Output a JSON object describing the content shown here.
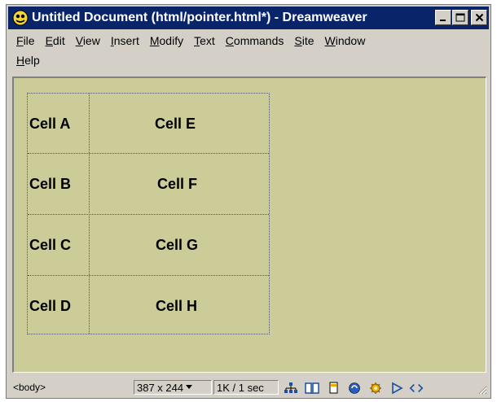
{
  "window": {
    "title": "Untitled Document (html/pointer.html*) - Dreamweaver"
  },
  "menu": {
    "items": [
      {
        "label": "File",
        "ul": "F",
        "rest": "ile"
      },
      {
        "label": "Edit",
        "ul": "E",
        "rest": "dit"
      },
      {
        "label": "View",
        "ul": "V",
        "rest": "iew"
      },
      {
        "label": "Insert",
        "ul": "I",
        "rest": "nsert"
      },
      {
        "label": "Modify",
        "ul": "M",
        "rest": "odify"
      },
      {
        "label": "Text",
        "ul": "T",
        "rest": "ext"
      },
      {
        "label": "Commands",
        "ul": "C",
        "rest": "ommands"
      },
      {
        "label": "Site",
        "ul": "S",
        "rest": "ite"
      },
      {
        "label": "Window",
        "ul": "W",
        "rest": "indow"
      },
      {
        "label": "Help",
        "ul": "H",
        "rest": "elp"
      }
    ]
  },
  "table": {
    "cells": [
      "Cell A",
      "Cell E",
      "Cell B",
      "Cell F",
      "Cell C",
      "Cell G",
      "Cell D",
      "Cell H"
    ]
  },
  "status": {
    "tag": "<body>",
    "size": "387 x 244",
    "download": "1K / 1 sec",
    "icons": [
      "site-map-icon",
      "library-icon",
      "html-styles-icon",
      "css-styles-icon",
      "behaviors-icon",
      "timelines-icon",
      "html-source-icon"
    ]
  },
  "colors": {
    "title_bg": "#0a246a",
    "document_bg": "#cccc99",
    "chrome": "#d4d0c8"
  }
}
